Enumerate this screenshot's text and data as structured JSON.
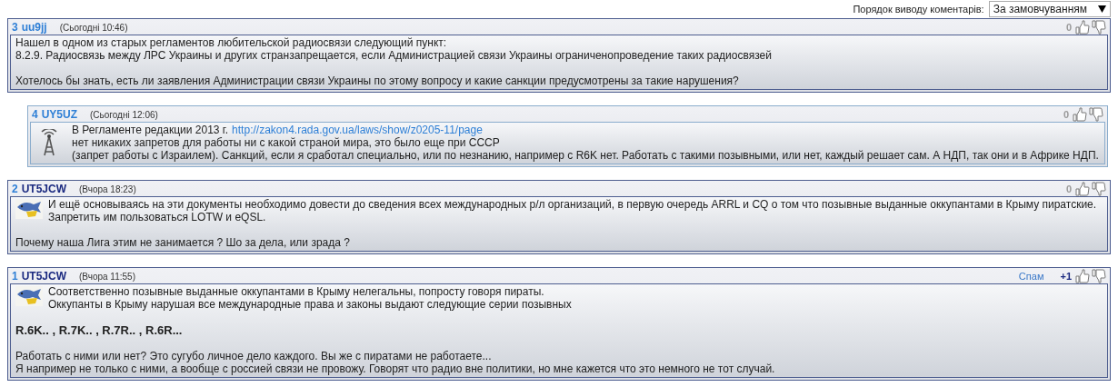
{
  "sort": {
    "label": "Порядок виводу коментарів:",
    "value": "За замовчуванням"
  },
  "comments": [
    {
      "number": "3",
      "author": {
        "name": "uu9jj",
        "color": "#2e7fd6"
      },
      "date": "(Сьогодні 10:46)",
      "reply": false,
      "rating": {
        "text": "0",
        "color": "#9a9a9a"
      },
      "paragraphs": [
        {
          "kind": "text",
          "lines": [
            {
              "text": "Нашел в одном из старых регламентов любительской радиосвязи следующий пункт:"
            },
            {
              "text": "8.2.9. Радиосвязь между ЛРС Украины и других странзапрещается, если Администрацией связи Украины ограниченопроведение таких радиосвязей"
            }
          ]
        },
        {
          "kind": "text",
          "lines": [
            {
              "text": "Хотелось бы знать, есть ли заявления Администрации связи Украины по этому вопросу и какие санкции предусмотрены за такие нарушения?"
            }
          ]
        }
      ]
    },
    {
      "number": "4",
      "author": {
        "name": "UY5UZ",
        "color": "#2e7fd6"
      },
      "date": "(Сьогодні 12:06)",
      "reply": true,
      "avatar": {
        "kind": "antenna"
      },
      "rating": {
        "text": "0",
        "color": "#9a9a9a"
      },
      "paragraphs": [
        {
          "kind": "text",
          "lines": [
            {
              "text": "В Регламенте редакции 2013 г.",
              "link": "http://zakon4.rada.gov.ua/laws/show/z0205-11/page"
            },
            {
              "text": "нет никаких запретов для работы ни с какой страной мира, это было еще при СССР"
            },
            {
              "text": "(запрет работы с Израилем). Санкций, если я сработал специально, или по незнанию, например с R6K нет. Работать с такими позывными, или нет, каждый решает сам. А НДП, так они и в Африке НДП."
            }
          ]
        }
      ]
    },
    {
      "number": "2",
      "author": {
        "name": "UT5JCW",
        "color": "#1b2a80"
      },
      "date": "(Вчора 18:23)",
      "reply": false,
      "avatar": {
        "kind": "fish"
      },
      "rating": {
        "text": "0",
        "color": "#9a9a9a"
      },
      "paragraphs": [
        {
          "kind": "text",
          "lines": [
            {
              "text": "И ещё основываясь на эти документы необходимо довести до сведения всех международных р/л организаций, в первую очередь ARRL и CQ о том что позывные выданные оккупантами в Крыму пиратские. Запретить им пользоваться LOTW и eQSL."
            }
          ]
        },
        {
          "kind": "text",
          "lines": [
            {
              "text": "Почему наша Лига этим не занимается ? Шо за дела, или зрада ?"
            }
          ]
        }
      ]
    },
    {
      "number": "1",
      "author": {
        "name": "UT5JCW",
        "color": "#1b2a80"
      },
      "date": "(Вчора 11:55)",
      "reply": false,
      "avatar": {
        "kind": "fish"
      },
      "spam": "Спам",
      "rating": {
        "text": "+1",
        "color": "#1b2a80"
      },
      "paragraphs": [
        {
          "kind": "text",
          "lines": [
            {
              "text": "Соответственно позывные выданные оккупантами в Крыму нелегальны, попросту говоря пираты."
            },
            {
              "text": "Оккупанты в Крыму нарушая все международные права и законы выдают следующие серии позывных"
            }
          ]
        },
        {
          "kind": "bold",
          "lines": [
            {
              "text": "R.6K.. , R.7K.. , R.7R.. , R.6R..."
            }
          ]
        },
        {
          "kind": "text",
          "lines": [
            {
              "text": "Работать с ними или нет? Это сугубо личное дело каждого. Вы же с пиратами не работаете..."
            },
            {
              "text": "Я например не только с ними, а вообще с россией связи не провожу. Говорят что радио вне политики, но мне кажется что это немного не тот случай."
            }
          ]
        }
      ]
    }
  ]
}
